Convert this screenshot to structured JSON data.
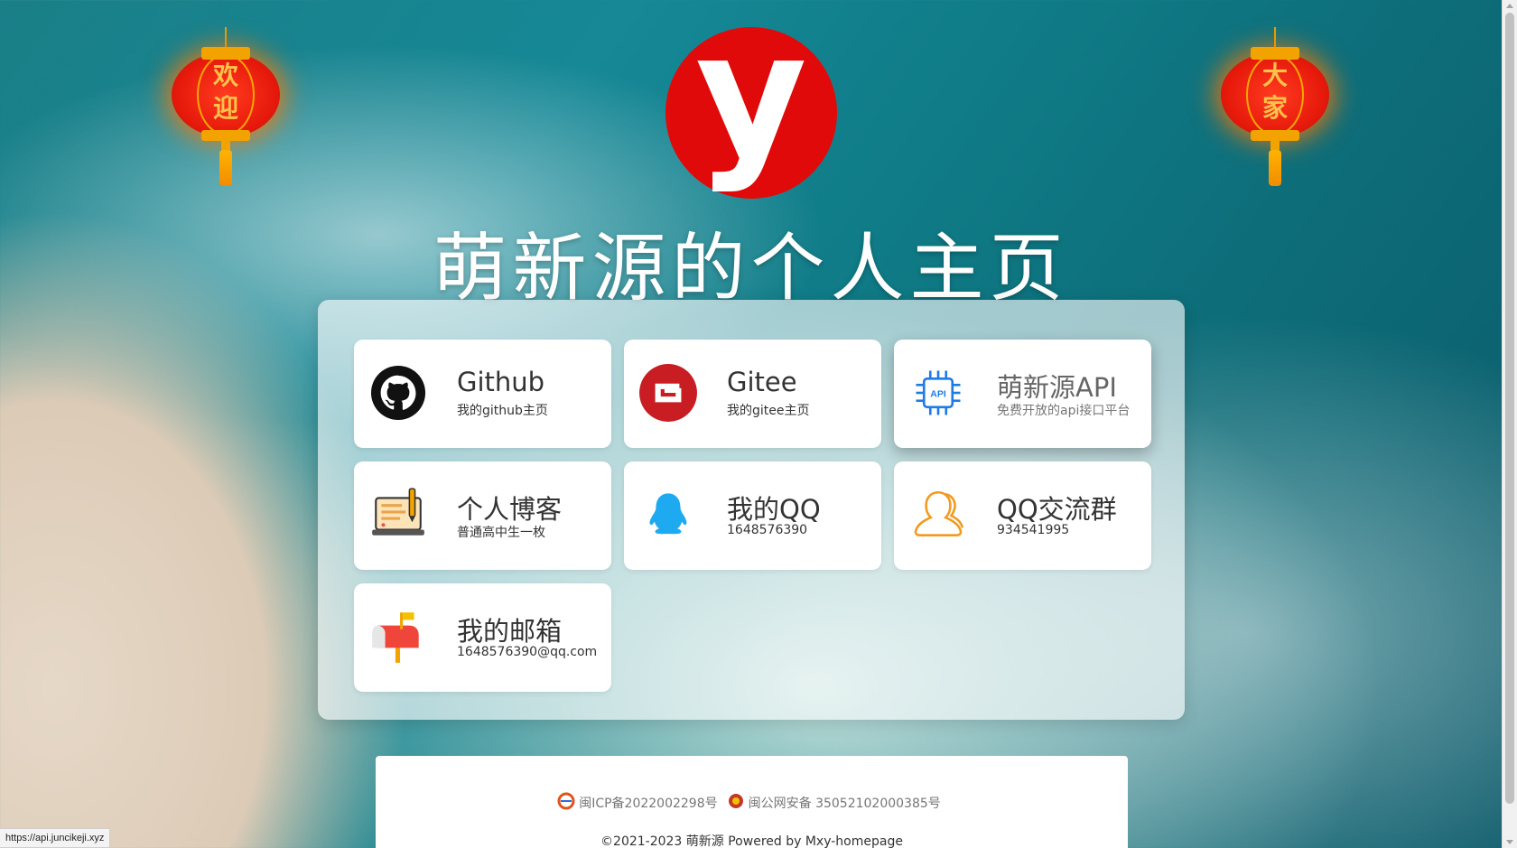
{
  "lanterns": {
    "left": {
      "text": "欢迎"
    },
    "right": {
      "text": "大家"
    }
  },
  "logo": {
    "letter": "y"
  },
  "page_title": "萌新源的个人主页",
  "cards": [
    {
      "title": "Github",
      "subtitle": "我的github主页",
      "icon": "github-icon"
    },
    {
      "title": "Gitee",
      "subtitle": "我的gitee主页",
      "icon": "gitee-icon"
    },
    {
      "title": "萌新源API",
      "subtitle": "免费开放的api接口平台",
      "icon": "api-chip-icon"
    },
    {
      "title": "个人博客",
      "subtitle": "普通高中生一枚",
      "icon": "blog-laptop-icon"
    },
    {
      "title": "我的QQ",
      "subtitle": "1648576390",
      "icon": "qq-penguin-icon"
    },
    {
      "title": "QQ交流群",
      "subtitle": "934541995",
      "icon": "group-person-icon"
    },
    {
      "title": "我的邮箱",
      "subtitle": "1648576390@qq.com",
      "icon": "mailbox-icon"
    }
  ],
  "footer": {
    "icp": "闽ICP备2022002298号",
    "police": "闽公网安备 35052102000385号",
    "copyright": "©2021-2023 萌新源 Powered by Mxy-homepage"
  },
  "status_bar": {
    "url": "https://api.juncikeji.xyz"
  },
  "colors": {
    "accent": "#e10a0a",
    "lantern": "#e81b0c",
    "gold": "#f2a300"
  }
}
